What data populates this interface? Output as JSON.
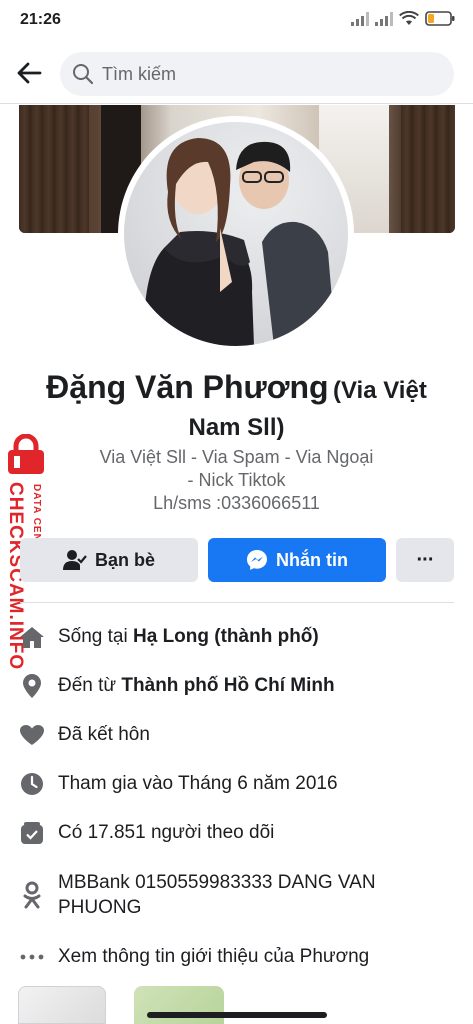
{
  "status_bar": {
    "time": "21:26"
  },
  "search": {
    "placeholder": "Tìm kiếm"
  },
  "profile": {
    "name": "Đặng Văn Phương",
    "alternate_name": "(Via Việt Nam Sll)",
    "bio_line1": "Via Việt Sll - Via Spam - Via Ngoại",
    "bio_line2": "- Nick Tiktok",
    "bio_line3": "Lh/sms :0336066511"
  },
  "actions": {
    "friends_label": "Bạn bè",
    "message_label": "Nhắn tin",
    "more_label": "···"
  },
  "details": {
    "lives_prefix": "Sống tại ",
    "lives_place": "Hạ Long (thành phố)",
    "from_prefix": "Đến từ ",
    "from_place": "Thành phố Hồ Chí Minh",
    "relationship": "Đã kết hôn",
    "joined": "Tham gia vào Tháng 6 năm 2016",
    "followers": "Có 17.851 người theo dõi",
    "bank": "MBBank 0150559983333 DANG VAN PHUONG",
    "see_more": "Xem thông tin giới thiệu của Phương"
  },
  "watermark": {
    "brand": "CHECKSCAM.INFO",
    "subtitle": "DATA CENTER"
  },
  "colors": {
    "accent": "#1877f2",
    "button_grey": "#e4e6eb",
    "secondary_text": "#65676b",
    "watermark_red": "#e0262b"
  },
  "icons": [
    "back-arrow-icon",
    "search-icon",
    "friends-check-icon",
    "messenger-icon",
    "home-icon",
    "location-pin-icon",
    "heart-icon",
    "clock-icon",
    "followers-icon",
    "odnoklassniki-icon",
    "ellipsis-icon",
    "lock-icon",
    "signal-icon",
    "wifi-icon",
    "battery-icon"
  ]
}
